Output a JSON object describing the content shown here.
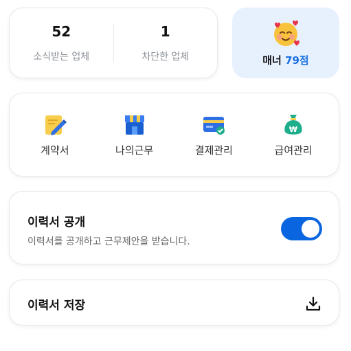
{
  "stats": {
    "subscribed_count": "52",
    "subscribed_label": "소식받는 업체",
    "blocked_count": "1",
    "blocked_label": "차단한 업체"
  },
  "manner": {
    "prefix": "매너 ",
    "score": "79점",
    "icon": "smiling-face-with-hearts-icon"
  },
  "menu": {
    "items": [
      {
        "label": "계약서",
        "icon": "contract-pencil-icon"
      },
      {
        "label": "나의근무",
        "icon": "store-icon"
      },
      {
        "label": "결제관리",
        "icon": "credit-card-icon"
      },
      {
        "label": "급여관리",
        "icon": "money-bag-icon"
      }
    ]
  },
  "resume_public": {
    "title": "이력서 공개",
    "description": "이력서를 공개하고 근무제안을 받습니다.",
    "toggle_on": true
  },
  "resume_save": {
    "title": "이력서 저장",
    "icon": "download-icon"
  },
  "colors": {
    "accent": "#0a66e0",
    "manner_bg": "#e7f1fe",
    "score": "#1a6fe0"
  }
}
